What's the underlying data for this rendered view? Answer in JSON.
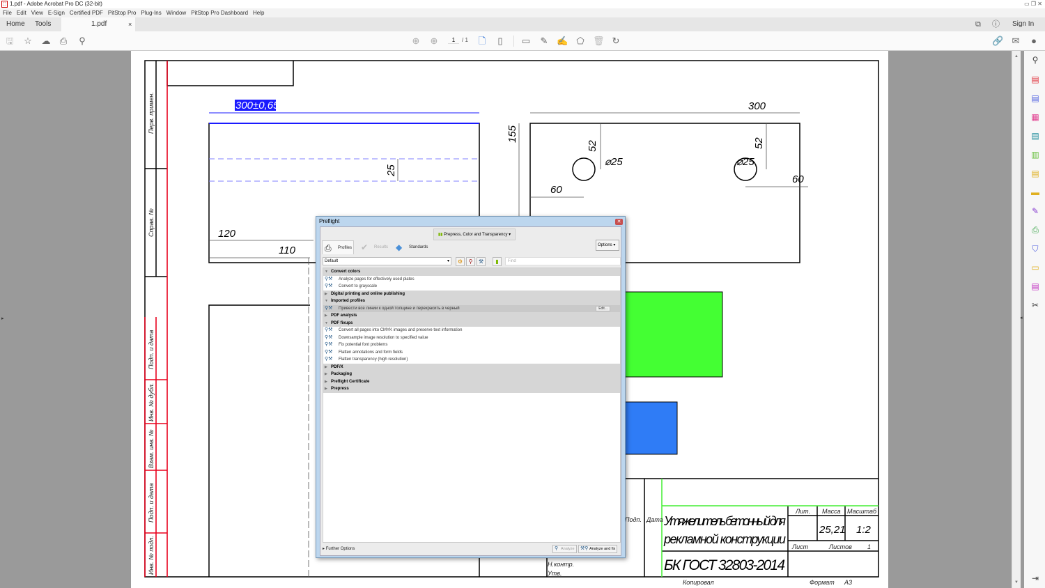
{
  "window": {
    "title": "1.pdf - Adobe Acrobat Pro DC (32-bit)"
  },
  "menu": [
    "File",
    "Edit",
    "View",
    "E-Sign",
    "Certified PDF",
    "PitStop Pro",
    "Plug-Ins",
    "Window",
    "PitStop Pro Dashboard",
    "Help"
  ],
  "tabs": {
    "home": "Home",
    "tools": "Tools",
    "doc": "1.pdf",
    "close": "×",
    "sign_in": "Sign In"
  },
  "toolbar": {
    "page_current": "1",
    "page_total": "/ 1"
  },
  "drawing": {
    "dim_selected": "300±0,65",
    "dim_25": "25",
    "dim_120": "120",
    "dim_110": "110",
    "dim_60_partial": "60",
    "dim_300": "300",
    "dim_155": "155",
    "dim_52a": "52",
    "dim_52b": "52",
    "dia_a": "⌀25",
    "dia_b": "⌀25",
    "dim_60a": "60",
    "dim_60b": "60",
    "side_labels": [
      "Перв. примен.",
      "Справ. №",
      "Подп. и дата",
      "Инв. № дубл.",
      "Взам. инв. №",
      "Подп. и дата",
      "Инв. № подл."
    ],
    "stamp": {
      "title_line1": "Утяжелитель бетонный для",
      "title_line2": "рекламной конструкции",
      "designation": "БК ГОСТ 32803-2014",
      "lit": "Лит.",
      "mass_label": "Масса",
      "scale_label": "Масштаб",
      "mass": "25,21",
      "scale": "1:2",
      "sheet": "Лист",
      "sheets": "Листов",
      "sheets_value": "1",
      "podp": "Подп.",
      "data": "Дата",
      "nkontr": "Н.контр.",
      "utv": "Утв.",
      "copied": "Копировал",
      "format": "Формат",
      "format_value": "А3"
    },
    "colors": {
      "green_rect": "#44ff33",
      "blue_rect": "#2f7cf6",
      "frame_red": "#e8001c",
      "selection": "#1a1aff"
    }
  },
  "preflight": {
    "title": "Preflight",
    "profile_group": "Prepress, Color and Transparency",
    "tabs": [
      "Profiles",
      "Results",
      "Standards"
    ],
    "options": "Options",
    "library": "Default",
    "find_placeholder": "Find",
    "rows": [
      {
        "type": "group",
        "label": "Convert colors",
        "open": true
      },
      {
        "type": "item",
        "label": "Analyze pages for effectively used plates"
      },
      {
        "type": "item",
        "label": "Convert to grayscale"
      },
      {
        "type": "group",
        "label": "Digital printing and online publishing",
        "open": false
      },
      {
        "type": "group",
        "label": "Imported profiles",
        "open": true
      },
      {
        "type": "item",
        "label": "Привести все линии к одной толщине и перекрасить в черный",
        "selected": true,
        "edit": "Edit..."
      },
      {
        "type": "group",
        "label": "PDF analysis",
        "open": false
      },
      {
        "type": "group",
        "label": "PDF fixups",
        "open": true
      },
      {
        "type": "item",
        "label": "Convert all pages into CMYK images and preserve text information"
      },
      {
        "type": "item",
        "label": "Downsample image resolution to specified value"
      },
      {
        "type": "item",
        "label": "Fix potential font problems"
      },
      {
        "type": "item",
        "label": "Flatten annotations and form fields"
      },
      {
        "type": "item",
        "label": "Flatten transparency (high resolution)"
      },
      {
        "type": "group",
        "label": "PDF/X",
        "open": false
      },
      {
        "type": "group",
        "label": "Packaging",
        "open": false
      },
      {
        "type": "group",
        "label": "Preflight Certificate",
        "open": false
      },
      {
        "type": "group",
        "label": "Prepress",
        "open": false
      }
    ],
    "further_options": "Further Options",
    "analyze": "Analyze",
    "analyze_fix": "Analyze and fix"
  }
}
